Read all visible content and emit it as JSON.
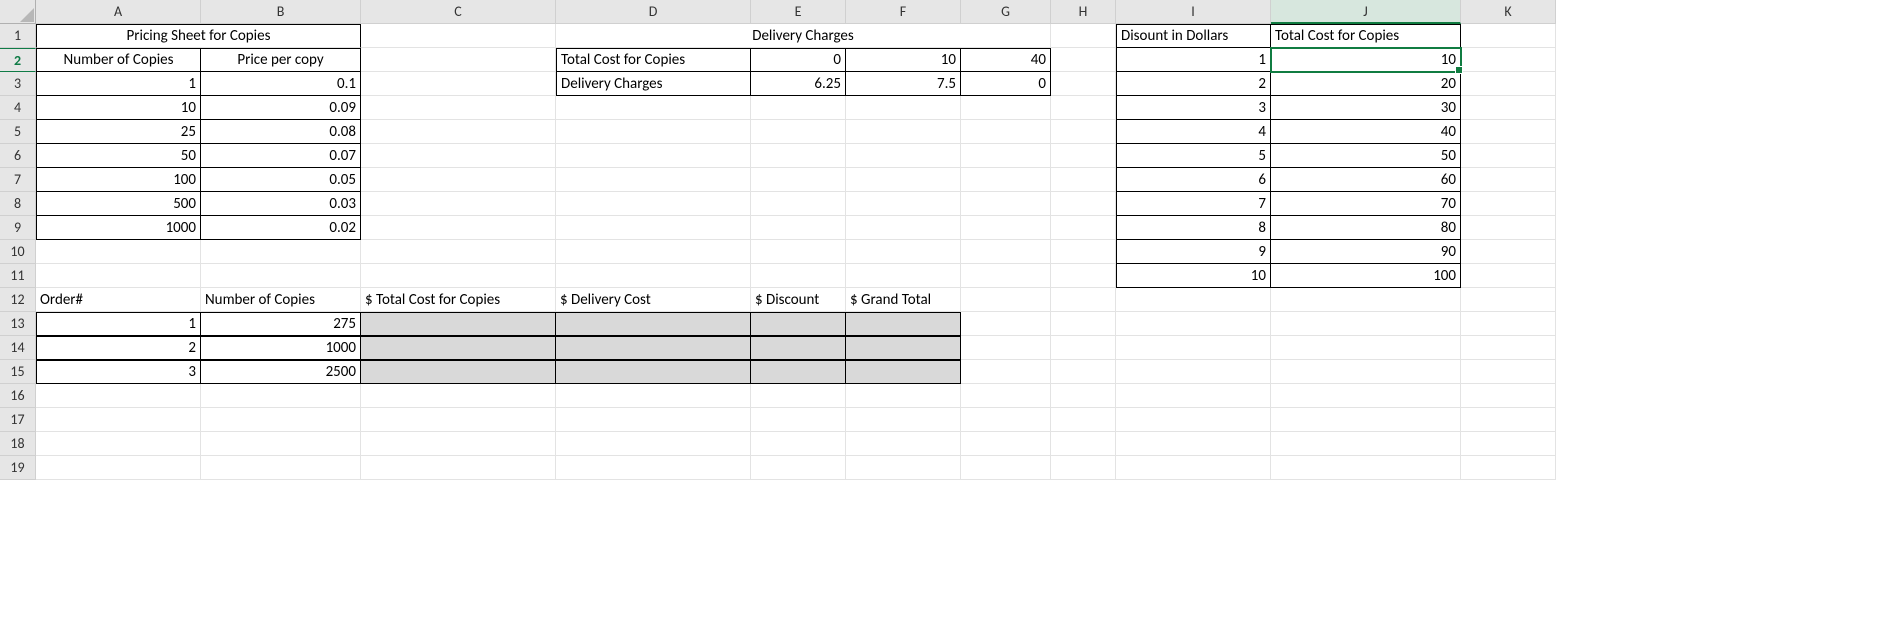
{
  "columns": [
    "A",
    "B",
    "C",
    "D",
    "E",
    "F",
    "G",
    "H",
    "I",
    "J",
    "K"
  ],
  "rows": 19,
  "activeCell": "J2",
  "pricing": {
    "title": "Pricing Sheet for Copies",
    "colA": "Number of Copies",
    "colB": "Price per copy",
    "rows": [
      {
        "n": "1",
        "p": "0.1"
      },
      {
        "n": "10",
        "p": "0.09"
      },
      {
        "n": "25",
        "p": "0.08"
      },
      {
        "n": "50",
        "p": "0.07"
      },
      {
        "n": "100",
        "p": "0.05"
      },
      {
        "n": "500",
        "p": "0.03"
      },
      {
        "n": "1000",
        "p": "0.02"
      }
    ]
  },
  "delivery": {
    "title": "Delivery Charges",
    "r1label": "Total Cost for Copies",
    "r1": [
      "0",
      "10",
      "40"
    ],
    "r2label": "Delivery Charges",
    "r2": [
      "6.25",
      "7.5",
      "0"
    ]
  },
  "discount": {
    "colI": "Disount in Dollars",
    "colJ": "Total Cost for Copies",
    "rows": [
      {
        "i": "1",
        "j": "10"
      },
      {
        "i": "2",
        "j": "20"
      },
      {
        "i": "3",
        "j": "30"
      },
      {
        "i": "4",
        "j": "40"
      },
      {
        "i": "5",
        "j": "50"
      },
      {
        "i": "6",
        "j": "60"
      },
      {
        "i": "7",
        "j": "70"
      },
      {
        "i": "8",
        "j": "80"
      },
      {
        "i": "9",
        "j": "90"
      },
      {
        "i": "10",
        "j": "100"
      }
    ]
  },
  "orders": {
    "h": [
      "Order#",
      "Number of Copies",
      "$ Total Cost for Copies",
      "$ Delivery Cost",
      "$ Discount",
      "$ Grand Total"
    ],
    "rows": [
      {
        "o": "1",
        "n": "275"
      },
      {
        "o": "2",
        "n": "1000"
      },
      {
        "o": "3",
        "n": "2500"
      }
    ]
  }
}
